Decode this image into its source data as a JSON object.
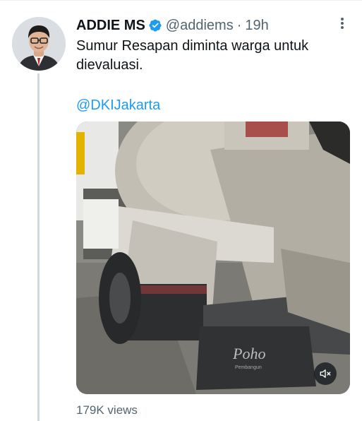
{
  "tweet": {
    "display_name": "ADDIE MS",
    "handle": "@addiems",
    "separator": "·",
    "time": "19h",
    "text": "Sumur Resapan diminta warga untuk\ndievaluasi.",
    "mention": "@DKIJakarta",
    "views": "179K views",
    "verified": true
  },
  "media": {
    "type": "video",
    "watermark": "Poho",
    "watermark_sub": "Pembangun",
    "muted": true
  },
  "icons": {
    "verified": "verified-badge-icon",
    "more": "more-dots-icon",
    "mute": "speaker-muted-icon"
  },
  "colors": {
    "accent": "#1d9bf0",
    "text": "#0f1419",
    "secondary": "#536471",
    "thread_line": "#cfd9de"
  }
}
